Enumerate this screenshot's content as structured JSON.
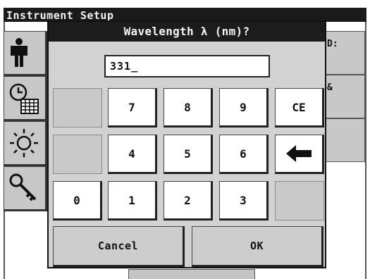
{
  "background": {
    "title": "Instrument Setup",
    "right_panels": [
      "D:",
      "&",
      ""
    ]
  },
  "dialog": {
    "title": "Wavelength λ (nm)?",
    "entry_value": "331_",
    "keypad": {
      "row1": [
        "7",
        "8",
        "9",
        "CE"
      ],
      "row2": [
        "4",
        "5",
        "6"
      ],
      "row3": [
        "0",
        "1",
        "2",
        "3"
      ],
      "backspace_icon": "left-arrow-icon"
    },
    "cancel_label": "Cancel",
    "ok_label": "OK"
  }
}
